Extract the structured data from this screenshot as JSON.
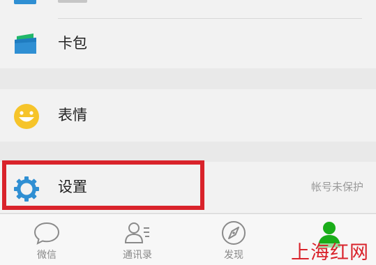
{
  "menu": {
    "card_label": "卡包",
    "sticker_label": "表情",
    "settings_label": "设置",
    "settings_status": "帐号未保护",
    "top_icon": "partial-blue-icon",
    "card_icon": "card-wallet-icon",
    "sticker_icon": "smiley-face-icon",
    "settings_icon": "gear-icon"
  },
  "tabs": [
    {
      "label": "微信",
      "icon": "chat-bubble-icon"
    },
    {
      "label": "通讯录",
      "icon": "contacts-icon"
    },
    {
      "label": "发现",
      "icon": "compass-icon"
    },
    {
      "label": "",
      "icon": "person-icon",
      "active": true
    }
  ],
  "watermark": "上海红网",
  "colors": {
    "highlight_red": "#d9232b",
    "card_blue": "#2f8fd3",
    "card_green": "#21b76a",
    "sticker_yellow": "#f6c42a",
    "gear_blue": "#2f8fd3",
    "me_green": "#1aad19"
  }
}
